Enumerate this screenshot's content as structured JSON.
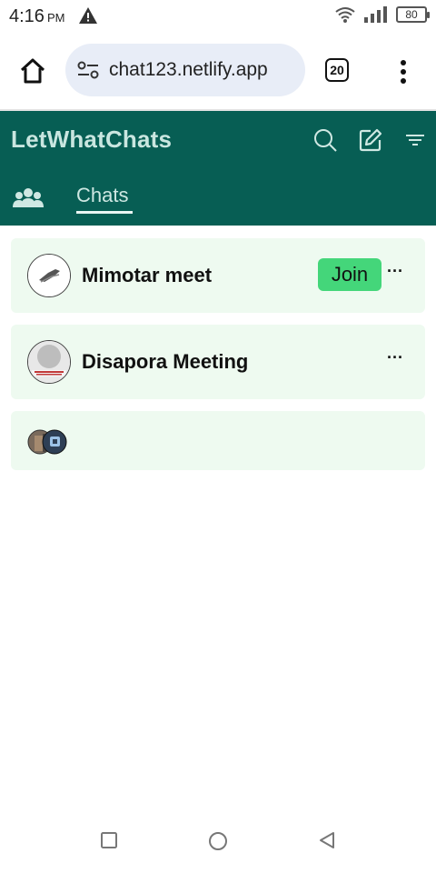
{
  "status": {
    "time": "4:16",
    "ampm": "PM",
    "battery": "80"
  },
  "browser": {
    "url": "chat123.netlify.app",
    "tab_count": "20"
  },
  "app": {
    "title": "LetWhatChats",
    "tabs": [
      {
        "label": "Chats"
      }
    ]
  },
  "chats": [
    {
      "name": "Mimotar meet",
      "action": "Join",
      "more": "···"
    },
    {
      "name": "Disapora Meeting",
      "more": "···"
    },
    {
      "name": ""
    }
  ],
  "colors": {
    "header": "#075e54",
    "card": "#eefaf0",
    "join": "#44d67a"
  }
}
